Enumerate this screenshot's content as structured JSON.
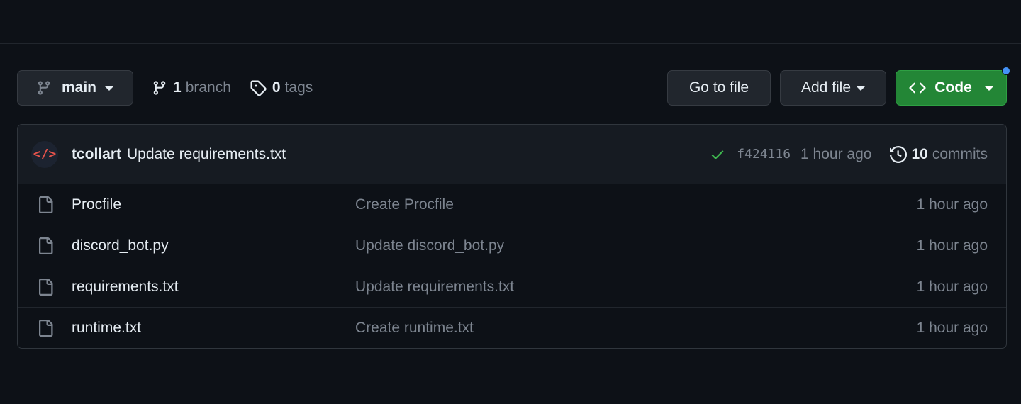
{
  "toolbar": {
    "branch_name": "main",
    "branch_count": "1",
    "branch_label": "branch",
    "tag_count": "0",
    "tag_label": "tags",
    "goto_file_label": "Go to file",
    "add_file_label": "Add file",
    "code_label": "Code"
  },
  "commit": {
    "avatar_glyph": "</>",
    "author": "tcollart",
    "message": "Update requirements.txt",
    "sha": "f424116",
    "time": "1 hour ago",
    "commit_count": "10",
    "commit_label": "commits"
  },
  "files": [
    {
      "name": "Procfile",
      "message": "Create Procfile",
      "time": "1 hour ago"
    },
    {
      "name": "discord_bot.py",
      "message": "Update discord_bot.py",
      "time": "1 hour ago"
    },
    {
      "name": "requirements.txt",
      "message": "Update requirements.txt",
      "time": "1 hour ago"
    },
    {
      "name": "runtime.txt",
      "message": "Create runtime.txt",
      "time": "1 hour ago"
    }
  ],
  "colors": {
    "background": "#0d1117",
    "code_button": "#238636",
    "check": "#3fb950",
    "avatar_accent": "#e5534b",
    "notification_dot": "#4493f8"
  }
}
